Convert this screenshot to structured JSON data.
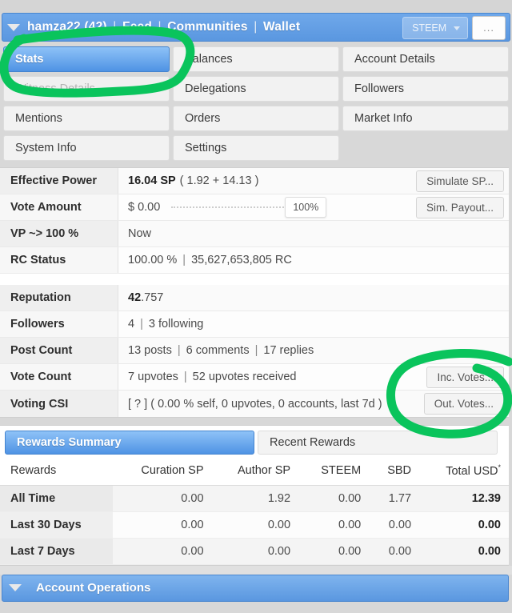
{
  "header": {
    "collapse_icon": "caret-down-icon",
    "username": "hamza22 (42)",
    "link_feed": "Feed",
    "link_communities": "Communities",
    "link_wallet": "Wallet",
    "separator": "|",
    "chain": "STEEM",
    "more_label": "...",
    "bg_color": "#5a97e0"
  },
  "tabs": [
    {
      "label": "Stats",
      "state": "active"
    },
    {
      "label": "Balances",
      "state": "normal"
    },
    {
      "label": "Account Details",
      "state": "normal"
    },
    {
      "label": "Witness Details",
      "state": "disabled"
    },
    {
      "label": "Delegations",
      "state": "normal"
    },
    {
      "label": "Followers",
      "state": "normal"
    },
    {
      "label": "Mentions",
      "state": "normal"
    },
    {
      "label": "Orders",
      "state": "normal"
    },
    {
      "label": "Market Info",
      "state": "normal"
    },
    {
      "label": "System Info",
      "state": "normal"
    },
    {
      "label": "Settings",
      "state": "normal"
    },
    {
      "label": "",
      "state": "empty"
    }
  ],
  "stats": {
    "effective_power": {
      "label": "Effective Power",
      "value_main": "16.04 SP",
      "value_detail": "( 1.92 + 14.13 )",
      "button": "Simulate SP..."
    },
    "vote_amount": {
      "label": "Vote Amount",
      "value": "$ 0.00",
      "slider_percent": "100%",
      "button": "Sim. Payout..."
    },
    "vp_100": {
      "label": "VP ~> 100 %",
      "value": "Now"
    },
    "rc_status": {
      "label": "RC Status",
      "percent": "100.00 %",
      "separator": "|",
      "rc": "35,627,653,805 RC"
    },
    "reputation": {
      "label": "Reputation",
      "value_bold": "42",
      "value_rest": ".757"
    },
    "followers": {
      "label": "Followers",
      "count": "4",
      "separator": "|",
      "following": "3 following"
    },
    "post_count": {
      "label": "Post Count",
      "posts": "13 posts",
      "comments": "6 comments",
      "replies": "17 replies",
      "separator": "|"
    },
    "vote_count": {
      "label": "Vote Count",
      "upvotes": "7 upvotes",
      "separator": "|",
      "received": "52 upvotes received",
      "button": "Inc. Votes..."
    },
    "voting_csi": {
      "label": "Voting CSI",
      "value": "[ ? ] ( 0.00 % self, 0 upvotes, 0 accounts, last 7d )",
      "button": "Out. Votes..."
    }
  },
  "rewards_panel": {
    "tab_summary": "Rewards Summary",
    "tab_recent": "Recent Rewards",
    "columns": [
      "Rewards",
      "Curation SP",
      "Author SP",
      "STEEM",
      "SBD",
      "Total USD"
    ],
    "total_col_superscript": "*",
    "rows": [
      {
        "period": "All Time",
        "curation_sp": "0.00",
        "author_sp": "1.92",
        "steem": "0.00",
        "sbd": "1.77",
        "total_usd": "12.39"
      },
      {
        "period": "Last 30 Days",
        "curation_sp": "0.00",
        "author_sp": "0.00",
        "steem": "0.00",
        "sbd": "0.00",
        "total_usd": "0.00"
      },
      {
        "period": "Last 7 Days",
        "curation_sp": "0.00",
        "author_sp": "0.00",
        "steem": "0.00",
        "sbd": "0.00",
        "total_usd": "0.00"
      }
    ]
  },
  "footer": {
    "collapse_icon": "caret-down-icon",
    "label": "Account Operations"
  },
  "annotations": {
    "color": "#0ac45c",
    "shapes": [
      "ellipse-around-stats-tab",
      "ellipse-around-vote-buttons"
    ]
  }
}
